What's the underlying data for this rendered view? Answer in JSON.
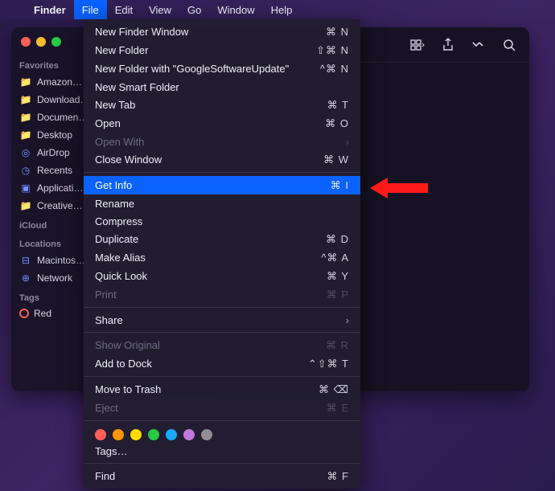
{
  "menubar": {
    "appName": "Finder",
    "items": [
      "File",
      "Edit",
      "View",
      "Go",
      "Window",
      "Help"
    ],
    "openIndex": 0
  },
  "sidebar": {
    "sections": {
      "favorites": {
        "label": "Favorites",
        "items": [
          "Amazon…",
          "Download…",
          "Document…",
          "Desktop",
          "AirDrop",
          "Recents",
          "Applicati…",
          "Creative…"
        ]
      },
      "icloud": {
        "label": "iCloud"
      },
      "locations": {
        "label": "Locations",
        "items": [
          "Macintos…",
          "Network"
        ]
      },
      "tags": {
        "label": "Tags",
        "items": [
          "Red"
        ]
      }
    }
  },
  "dropdown": {
    "groups": [
      [
        {
          "label": "New Finder Window",
          "shortcut": "⌘ N",
          "enabled": true
        },
        {
          "label": "New Folder",
          "shortcut": "⇧⌘ N",
          "enabled": true
        },
        {
          "label": "New Folder with \"GoogleSoftwareUpdate\"",
          "shortcut": "^⌘ N",
          "enabled": true
        },
        {
          "label": "New Smart Folder",
          "shortcut": "",
          "enabled": true
        },
        {
          "label": "New Tab",
          "shortcut": "⌘ T",
          "enabled": true
        },
        {
          "label": "Open",
          "shortcut": "⌘ O",
          "enabled": true
        },
        {
          "label": "Open With",
          "shortcut": "",
          "enabled": false,
          "submenu": true
        },
        {
          "label": "Close Window",
          "shortcut": "⌘ W",
          "enabled": true
        }
      ],
      [
        {
          "label": "Get Info",
          "shortcut": "⌘ I",
          "enabled": true,
          "highlight": true
        },
        {
          "label": "Rename",
          "shortcut": "",
          "enabled": true
        },
        {
          "label": "Compress",
          "shortcut": "",
          "enabled": true
        },
        {
          "label": "Duplicate",
          "shortcut": "⌘ D",
          "enabled": true
        },
        {
          "label": "Make Alias",
          "shortcut": "^⌘ A",
          "enabled": true
        },
        {
          "label": "Quick Look",
          "shortcut": "⌘ Y",
          "enabled": true
        },
        {
          "label": "Print",
          "shortcut": "⌘ P",
          "enabled": false
        }
      ],
      [
        {
          "label": "Share",
          "shortcut": "",
          "enabled": true,
          "submenu": true
        }
      ],
      [
        {
          "label": "Show Original",
          "shortcut": "⌘ R",
          "enabled": false
        },
        {
          "label": "Add to Dock",
          "shortcut": "⌃⇧⌘ T",
          "enabled": true
        }
      ],
      [
        {
          "label": "Move to Trash",
          "shortcut": "⌘ ⌫",
          "enabled": true
        },
        {
          "label": "Eject",
          "shortcut": "⌘ E",
          "enabled": false
        }
      ]
    ],
    "tagColors": [
      "#ff5f57",
      "#fe9500",
      "#fddc00",
      "#28c840",
      "#1ba8ff",
      "#c177dc",
      "#8e8e93"
    ],
    "tagsLabel": "Tags…",
    "find": {
      "label": "Find",
      "shortcut": "⌘ F"
    }
  }
}
